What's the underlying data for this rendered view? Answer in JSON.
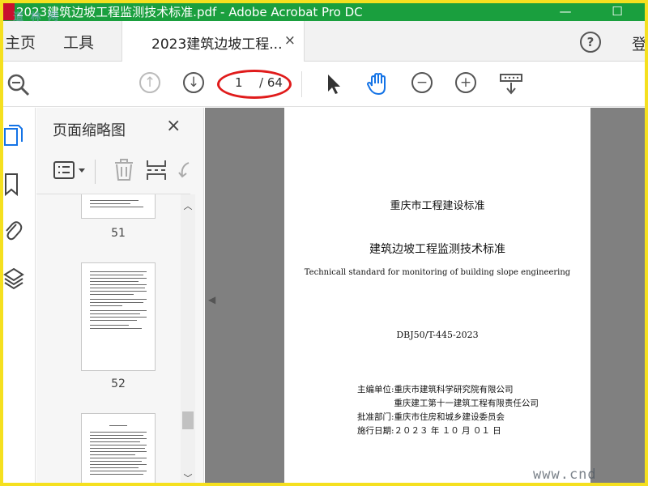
{
  "titlebar": {
    "title": "2023建筑边坡工程监测技术标准.pdf - Adobe Acrobat Pro DC",
    "minimize": "—",
    "maximize": "☐"
  },
  "menu": {
    "home": "主页",
    "tools": "工具",
    "doc_tab": "2023建筑边坡工程...",
    "tab_close": "×",
    "help": "?",
    "login": "登"
  },
  "toolbar": {
    "current_page": "1",
    "total_pages": "/ 64"
  },
  "panel": {
    "title": "页面缩略图",
    "close": "×",
    "thumbnails": [
      {
        "label": "51"
      },
      {
        "label": "52"
      },
      {
        "label": ""
      }
    ]
  },
  "document": {
    "org": "重庆市工程建设标准",
    "title_cn": "建筑边坡工程监测技术标准",
    "title_en": "Technicall standard for monitoring of building slope engineering",
    "code": "DBJ50/T-445-2023",
    "info": [
      "主编单位:重庆市建筑科学研究院有限公司",
      "　　　　 重庆建工第十一建筑工程有限责任公司",
      "批准部门:重庆市住房和城乡建设委员会",
      "施行日期:２０２３ 年 １０ 月 ０１ 日"
    ]
  },
  "watermarks": {
    "top_left": "道 林 网",
    "bottom_right": "www.cnd"
  },
  "colors": {
    "titlebar": "#1a9f3e",
    "frame": "#f5e01f",
    "accent": "#1473e6",
    "annotation": "#e01b1b"
  }
}
